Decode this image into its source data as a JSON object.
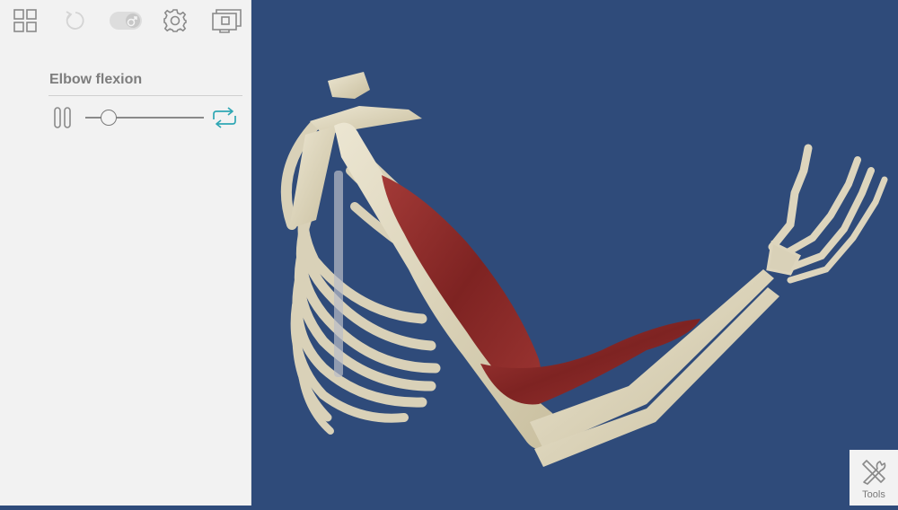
{
  "toolbar": {
    "icons": [
      "grid-view-icon",
      "reset-rotate-icon",
      "gender-toggle-icon",
      "settings-gear-icon",
      "screenshot-icon"
    ]
  },
  "animation": {
    "title": "Elbow flexion",
    "progress": 0.2,
    "loop_color": "#2fa7b4"
  },
  "viewport": {
    "background": "#2f4b7a",
    "subject": "Skeletal thorax and arm with biceps brachii and brachioradialis muscles"
  },
  "tools": {
    "label": "Tools"
  }
}
